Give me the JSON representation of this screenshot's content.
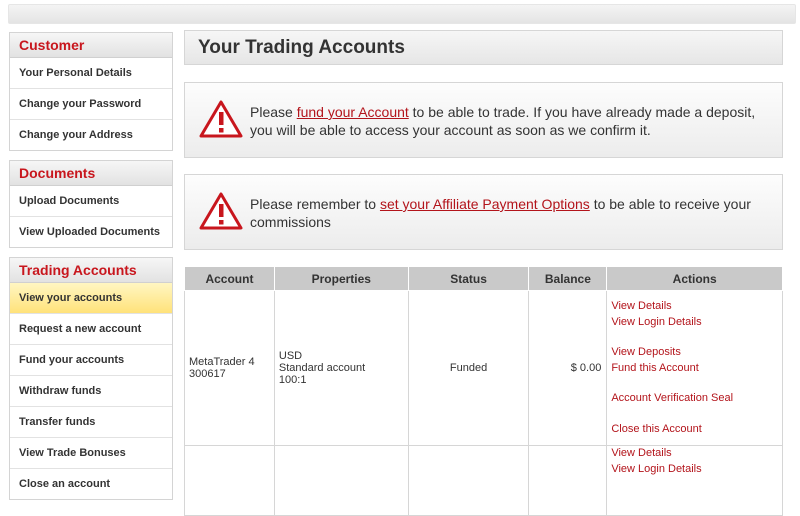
{
  "sidebar": {
    "customer": {
      "title": "Customer",
      "items": [
        "Your Personal Details",
        "Change your Password",
        "Change your Address"
      ]
    },
    "documents": {
      "title": "Documents",
      "items": [
        "Upload Documents",
        "View Uploaded Documents"
      ]
    },
    "trading": {
      "title": "Trading Accounts",
      "items": [
        "View your accounts",
        "Request a new account",
        "Fund your accounts",
        "Withdraw funds",
        "Transfer funds",
        "View Trade Bonuses",
        "Close an account"
      ],
      "active_index": 0
    }
  },
  "page_title": "Your Trading Accounts",
  "notices": [
    {
      "before": "Please ",
      "link": "fund your Account",
      "after": " to be able to trade. If you have already made a deposit, you will be able to access your account as soon as we confirm it."
    },
    {
      "before": "Please remember to ",
      "link": "set your Affiliate Payment Options",
      "after": " to be able to receive your commissions"
    }
  ],
  "table": {
    "headers": [
      "Account",
      "Properties",
      "Status",
      "Balance",
      "Actions"
    ],
    "rows": [
      {
        "account": [
          "MetaTrader 4",
          "300617"
        ],
        "properties": [
          "USD",
          "Standard account",
          "100:1"
        ],
        "status": "Funded",
        "balance": "$ 0.00",
        "actions": [
          "View Details",
          "View Login Details",
          "View Deposits",
          "Fund this Account",
          "Account Verification Seal",
          "Close this Account"
        ]
      },
      {
        "account": [
          "",
          ""
        ],
        "properties": [
          "",
          "",
          ""
        ],
        "status": "",
        "balance": "",
        "actions": [
          "View Details",
          "View Login Details"
        ]
      }
    ]
  },
  "colors": {
    "accent": "#c8161d",
    "link": "#b3141b",
    "active_item": "#ffe27a",
    "header": "#c9c9c9"
  },
  "icons": {
    "notice": "warning-triangle-icon"
  }
}
